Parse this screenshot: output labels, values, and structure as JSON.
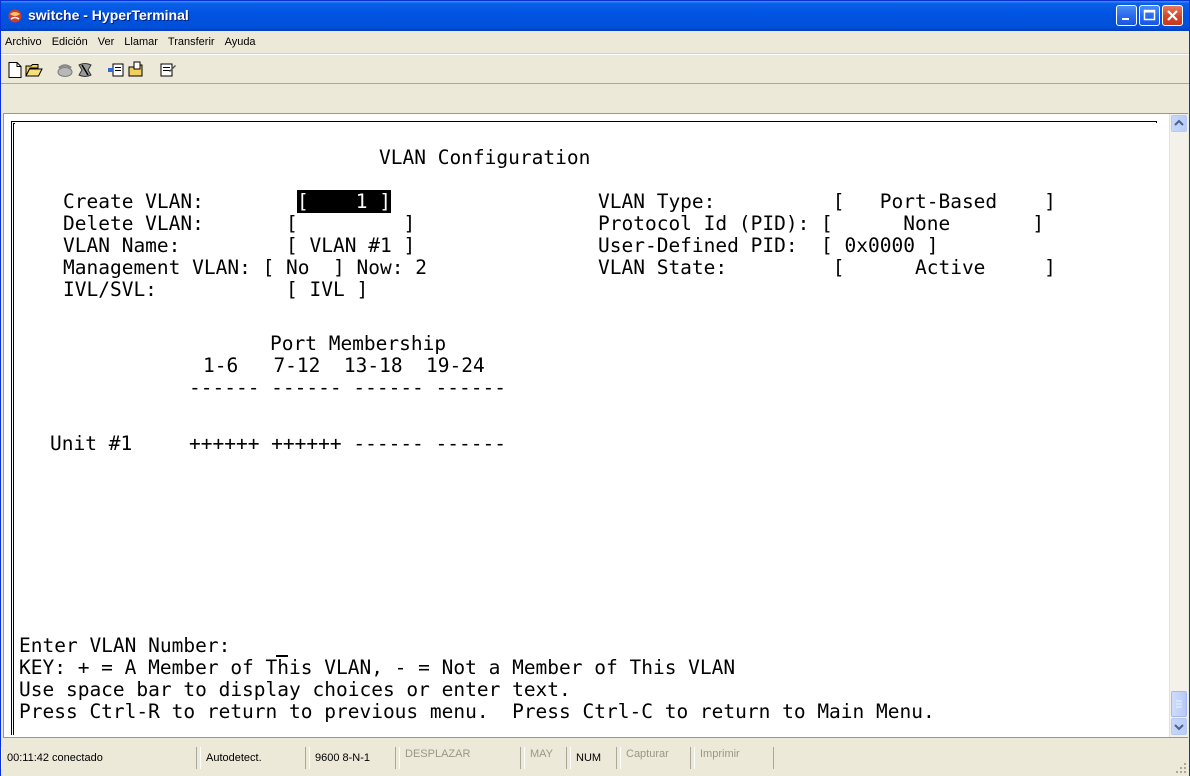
{
  "window": {
    "title": "switche - HyperTerminal"
  },
  "menu": [
    "Archivo",
    "Edición",
    "Ver",
    "Llamar",
    "Transferir",
    "Ayuda"
  ],
  "toolbar_icons": [
    "new-icon",
    "open-icon",
    "call-icon",
    "hang-up-icon",
    "send-icon",
    "receive-icon",
    "properties-icon"
  ],
  "terminal": {
    "heading": "VLAN Configuration",
    "fields": {
      "create_label": "Create VLAN:",
      "create_open": "[",
      "create_value": "    1 ]",
      "delete_line": "Delete VLAN:       [         ]",
      "name_line": "VLAN Name:         [ VLAN #1 ]",
      "mgmt_line": "Management VLAN: [ No  ] Now: 2",
      "ivl_line": "IVL/SVL:           [ IVL ]"
    },
    "right_fields": {
      "type_line": "VLAN Type:          [   Port-Based    ]",
      "pid_line": "Protocol Id (PID): [      None       ]",
      "udpid_line": "User-Defined PID:  [ 0x0000 ]",
      "state_line": "VLAN State:         [      Active     ]"
    },
    "membership": {
      "title": "Port Membership",
      "header": "1-6   7-12  13-18  19-24",
      "dashes": "------ ------ ------ ------",
      "unit_label": "Unit #1",
      "unit_values": "++++++ ++++++ ------ ------"
    },
    "prompt": "Enter VLAN Number:",
    "help": [
      "KEY: + = A Member of This VLAN, - = Not a Member of This VLAN",
      "Use space bar to display choices or enter text.",
      "Press Ctrl-R to return to previous menu.  Press Ctrl-C to return to Main Menu."
    ]
  },
  "status": {
    "time": "00:11:42 conectado",
    "detect": "Autodetect.",
    "settings": "9600 8-N-1",
    "scroll": "DESPLAZAR",
    "caps": "MAY",
    "num": "NUM",
    "capture": "Capturar",
    "print": "Imprimir"
  }
}
